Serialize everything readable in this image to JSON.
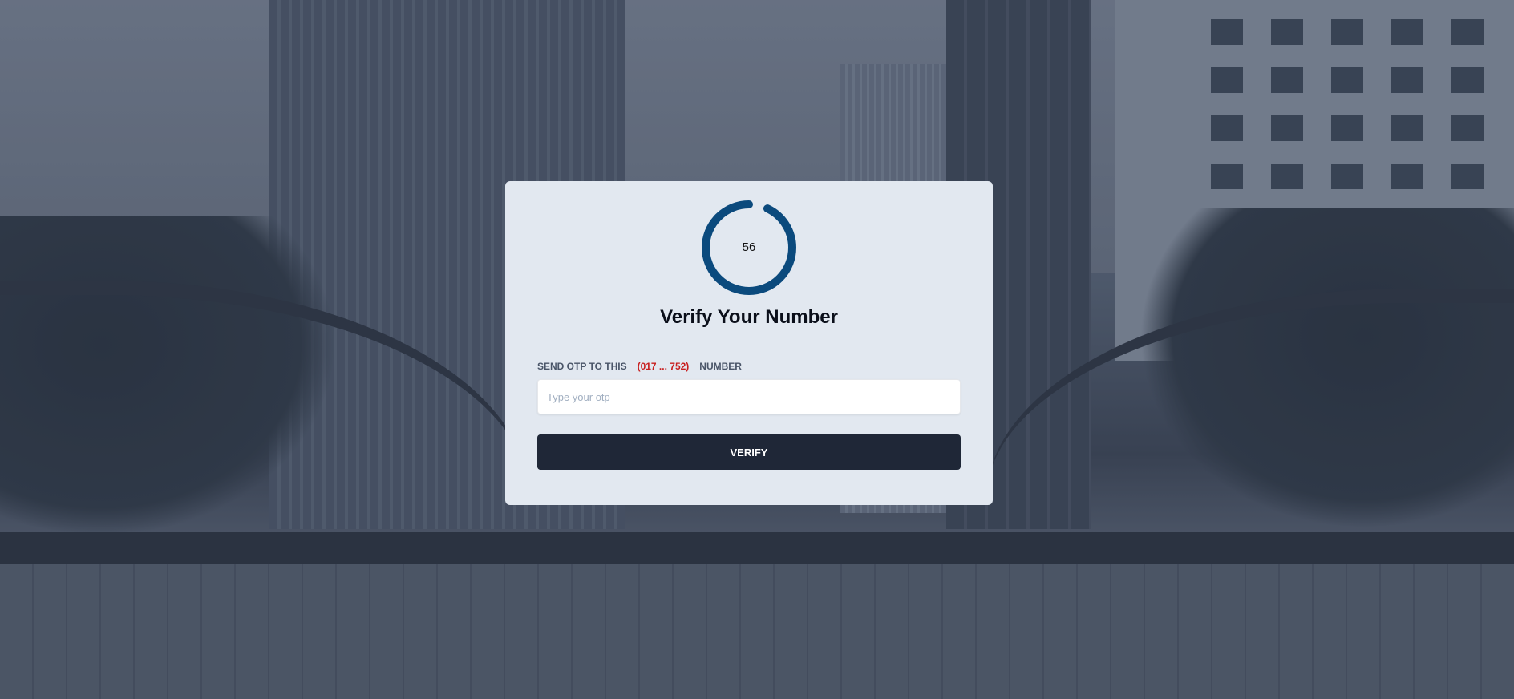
{
  "timer": {
    "value": "56",
    "progress": 0.93,
    "ring_color": "#0b4a7d",
    "track_color": "#e2e8f0"
  },
  "card": {
    "title": "Verify Your Number",
    "label_prefix": "SEND OTP TO THIS",
    "phone_masked": "(017 ... 752)",
    "label_suffix": "NUMBER",
    "otp_placeholder": "Type your otp",
    "otp_value": "",
    "verify_label": "VERIFY"
  },
  "colors": {
    "card_bg": "#e2e8f0",
    "button_bg": "#1f2737",
    "phone_color": "#c81e1e"
  }
}
